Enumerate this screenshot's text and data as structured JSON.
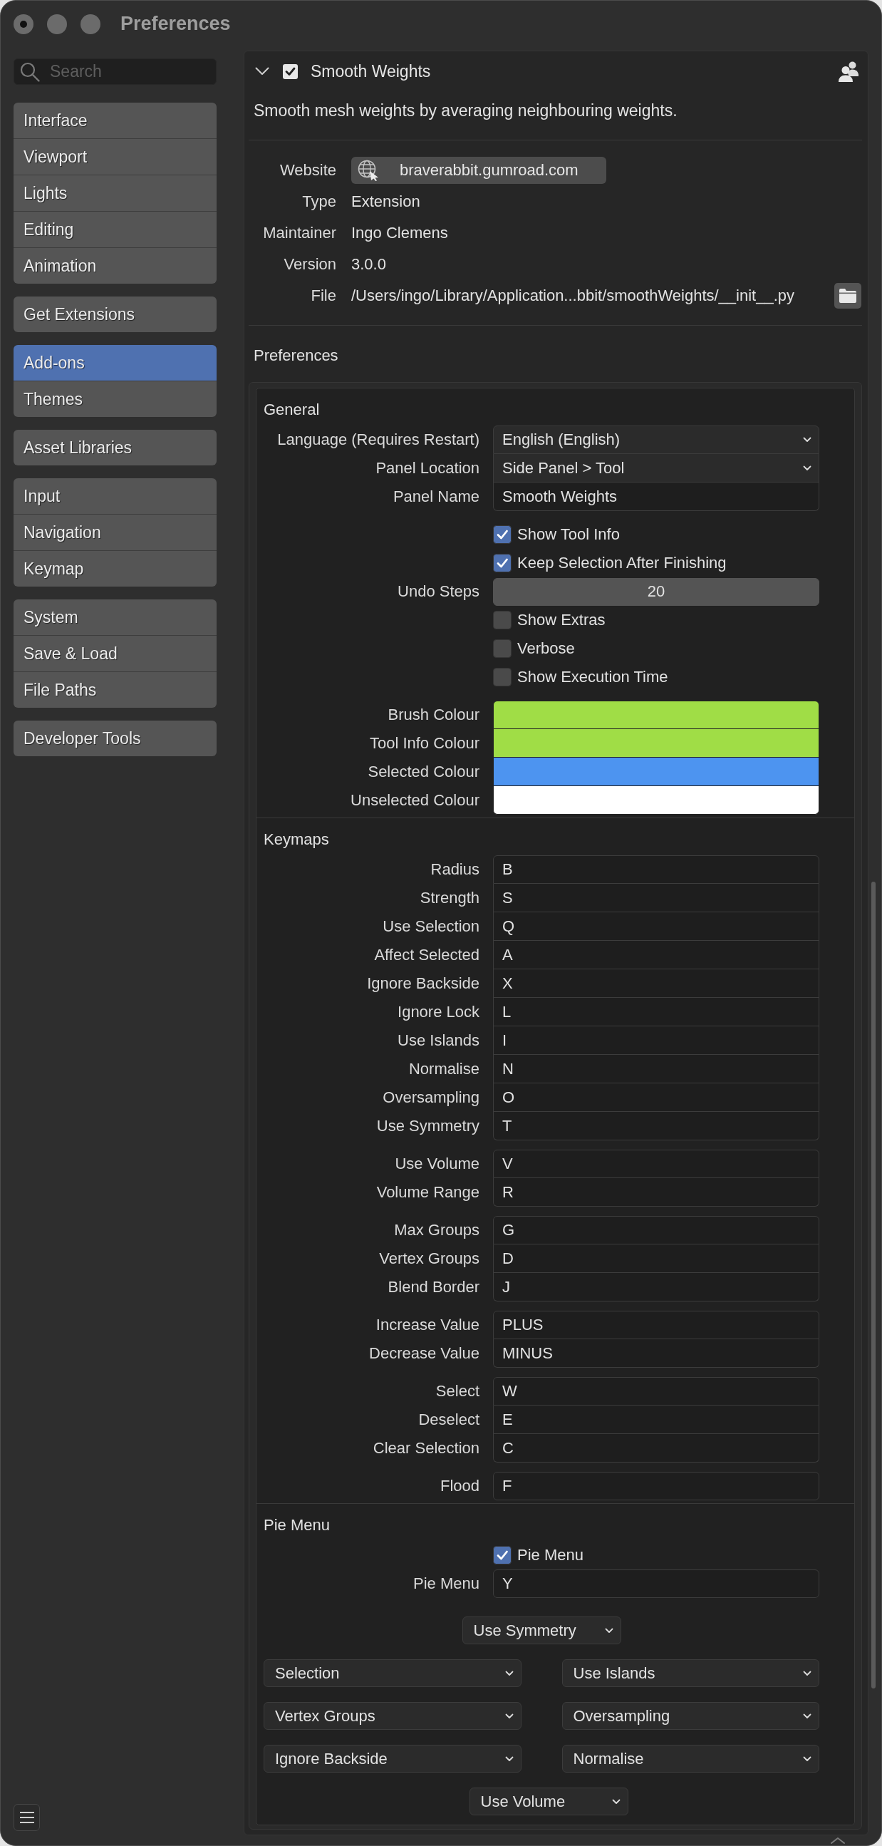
{
  "window": {
    "title": "Preferences"
  },
  "sidebar": {
    "search": {
      "placeholder": "Search"
    },
    "groups": [
      [
        {
          "label": "Interface",
          "selected": false
        },
        {
          "label": "Viewport",
          "selected": false
        },
        {
          "label": "Lights",
          "selected": false
        },
        {
          "label": "Editing",
          "selected": false
        },
        {
          "label": "Animation",
          "selected": false
        }
      ],
      [
        {
          "label": "Get Extensions",
          "selected": false
        }
      ],
      [
        {
          "label": "Add-ons",
          "selected": true
        },
        {
          "label": "Themes",
          "selected": false
        }
      ],
      [
        {
          "label": "Asset Libraries",
          "selected": false
        }
      ],
      [
        {
          "label": "Input",
          "selected": false
        },
        {
          "label": "Navigation",
          "selected": false
        },
        {
          "label": "Keymap",
          "selected": false
        }
      ],
      [
        {
          "label": "System",
          "selected": false
        },
        {
          "label": "Save & Load",
          "selected": false
        },
        {
          "label": "File Paths",
          "selected": false
        }
      ],
      [
        {
          "label": "Developer Tools",
          "selected": false
        }
      ]
    ]
  },
  "addon": {
    "name": "Smooth Weights",
    "expanded": true,
    "enabled": true,
    "description": "Smooth mesh weights by averaging neighbouring weights.",
    "info": [
      {
        "label": "Website",
        "value": "braverabbit.gumroad.com",
        "kind": "link"
      },
      {
        "label": "Type",
        "value": "Extension",
        "kind": "text"
      },
      {
        "label": "Maintainer",
        "value": "Ingo Clemens",
        "kind": "text"
      },
      {
        "label": "Version",
        "value": "3.0.0",
        "kind": "text"
      },
      {
        "label": "File",
        "value": "/Users/ingo/Library/Application...bbit/smoothWeights/__init__.py",
        "kind": "file"
      }
    ],
    "preferences_title": "Preferences"
  },
  "sections": [
    {
      "title": "General",
      "groups": [
        [
          {
            "kind": "dropdown",
            "label": "Language (Requires Restart)",
            "value": "English (English)"
          },
          {
            "kind": "dropdown",
            "label": "Panel Location",
            "value": "Side Panel > Tool"
          },
          {
            "kind": "text",
            "label": "Panel Name",
            "value": "Smooth Weights"
          }
        ],
        [
          {
            "kind": "checkbox",
            "text": "Show Tool Info",
            "checked": true
          },
          {
            "kind": "checkbox",
            "text": "Keep Selection After Finishing",
            "checked": true
          },
          {
            "kind": "number",
            "label": "Undo Steps",
            "value": "20"
          },
          {
            "kind": "checkbox",
            "text": "Show Extras",
            "checked": false
          },
          {
            "kind": "checkbox",
            "text": "Verbose",
            "checked": false
          },
          {
            "kind": "checkbox",
            "text": "Show Execution Time",
            "checked": false
          }
        ],
        [
          {
            "kind": "color",
            "label": "Brush Colour",
            "color": "#a0dd46"
          },
          {
            "kind": "color",
            "label": "Tool Info Colour",
            "color": "#a0dd46"
          },
          {
            "kind": "color",
            "label": "Selected Colour",
            "color": "#4d94f0"
          },
          {
            "kind": "color",
            "label": "Unselected Colour",
            "color": "#ffffff"
          }
        ]
      ]
    },
    {
      "title": "Keymaps",
      "groups": [
        [
          {
            "kind": "key",
            "label": "Radius",
            "value": "B"
          },
          {
            "kind": "key",
            "label": "Strength",
            "value": "S"
          },
          {
            "kind": "key",
            "label": "Use Selection",
            "value": "Q"
          },
          {
            "kind": "key",
            "label": "Affect Selected",
            "value": "A"
          },
          {
            "kind": "key",
            "label": "Ignore Backside",
            "value": "X"
          },
          {
            "kind": "key",
            "label": "Ignore Lock",
            "value": "L"
          },
          {
            "kind": "key",
            "label": "Use Islands",
            "value": "I"
          },
          {
            "kind": "key",
            "label": "Normalise",
            "value": "N"
          },
          {
            "kind": "key",
            "label": "Oversampling",
            "value": "O"
          },
          {
            "kind": "key",
            "label": "Use Symmetry",
            "value": "T"
          }
        ],
        [
          {
            "kind": "key",
            "label": "Use Volume",
            "value": "V"
          },
          {
            "kind": "key",
            "label": "Volume Range",
            "value": "R"
          }
        ],
        [
          {
            "kind": "key",
            "label": "Max Groups",
            "value": "G"
          },
          {
            "kind": "key",
            "label": "Vertex Groups",
            "value": "D"
          },
          {
            "kind": "key",
            "label": "Blend Border",
            "value": "J"
          }
        ],
        [
          {
            "kind": "key",
            "label": "Increase Value",
            "value": "PLUS"
          },
          {
            "kind": "key",
            "label": "Decrease Value",
            "value": "MINUS"
          }
        ],
        [
          {
            "kind": "key",
            "label": "Select",
            "value": "W"
          },
          {
            "kind": "key",
            "label": "Deselect",
            "value": "E"
          },
          {
            "kind": "key",
            "label": "Clear Selection",
            "value": "C"
          }
        ],
        [
          {
            "kind": "key",
            "label": "Flood",
            "value": "F"
          }
        ]
      ]
    },
    {
      "title": "Pie Menu",
      "groups": [
        [
          {
            "kind": "checkbox",
            "text": "Pie Menu",
            "checked": true
          },
          {
            "kind": "key",
            "label": "Pie Menu",
            "value": "Y"
          }
        ]
      ],
      "pie": {
        "top": "Use Symmetry",
        "pairs": [
          [
            "Selection",
            "Use Islands"
          ],
          [
            "Vertex Groups",
            "Oversampling"
          ],
          [
            "Ignore Backside",
            "Normalise"
          ]
        ],
        "bottom": "Use Volume"
      }
    }
  ]
}
